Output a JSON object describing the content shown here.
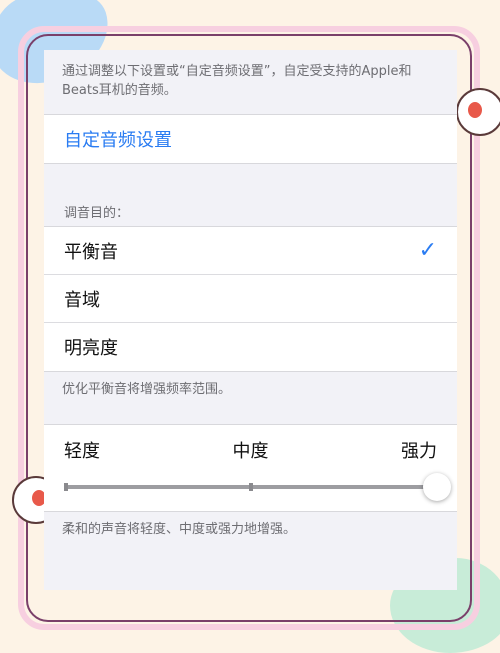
{
  "intro_text": "通过调整以下设置或“自定音频设置”，自定受支持的Apple和Beats耳机的音频。",
  "custom_audio_link": "自定音频设置",
  "tuning": {
    "header": "调音目的：",
    "options": [
      {
        "label": "平衡音",
        "selected": true
      },
      {
        "label": "音域",
        "selected": false
      },
      {
        "label": "明亮度",
        "selected": false
      }
    ],
    "footer": "优化平衡音将增强频率范围。"
  },
  "strength": {
    "labels": [
      "轻度",
      "中度",
      "强力"
    ],
    "value": 1.0,
    "footer": "柔和的声音将轻度、中度或强力地增强。"
  },
  "colors": {
    "accent": "#2a7cf2",
    "frame_pink": "#f7cfe0",
    "frame_purple": "#7a3f6a"
  }
}
